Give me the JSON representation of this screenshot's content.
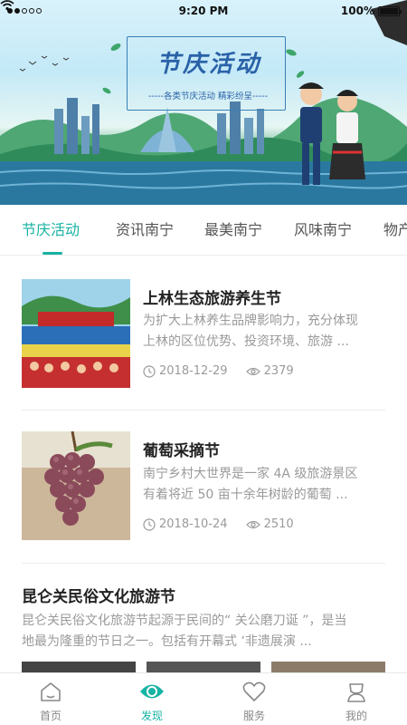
{
  "status_bar": {
    "time": "9:20 PM",
    "battery": "100%"
  },
  "banner": {
    "title": "节庆活动",
    "subtitle": "-----各类节庆活动  精彩纷呈-----"
  },
  "tabs": [
    {
      "label": "节庆活动",
      "active": true
    },
    {
      "label": "资讯南宁",
      "active": false
    },
    {
      "label": "最美南宁",
      "active": false
    },
    {
      "label": "风味南宁",
      "active": false
    },
    {
      "label": "物产",
      "active": false
    }
  ],
  "articles": [
    {
      "title": "上林生态旅游养生节",
      "desc_line1": "为扩大上林养生品牌影响力，充分体现",
      "desc_line2": "上林的区位优势、投资环境、旅游 ...",
      "date": "2018-12-29",
      "views": "2379"
    },
    {
      "title": "葡萄采摘节",
      "desc_line1": "南宁乡村大世界是一家 4A 级旅游景区",
      "desc_line2": "有着将近 50 亩十余年树龄的葡萄 ...",
      "date": "2018-10-24",
      "views": "2510"
    }
  ],
  "wide_article": {
    "title": "昆仑关民俗文化旅游节",
    "desc_line1": "昆仑关民俗文化旅游节起源于民间的“ 关公磨刀诞 ”，是当",
    "desc_line2": "地最为隆重的节日之一。包括有开幕式 ‘非遗展演 ..."
  },
  "bottom_nav": [
    {
      "label": "首页",
      "icon": "home-icon",
      "active": false
    },
    {
      "label": "发现",
      "icon": "eye-icon",
      "active": true
    },
    {
      "label": "服务",
      "icon": "heart-icon",
      "active": false
    },
    {
      "label": "我的",
      "icon": "user-icon",
      "active": false
    }
  ],
  "colors": {
    "accent": "#17b3a3",
    "text_primary": "#222222",
    "text_secondary": "#9a9a9a"
  }
}
